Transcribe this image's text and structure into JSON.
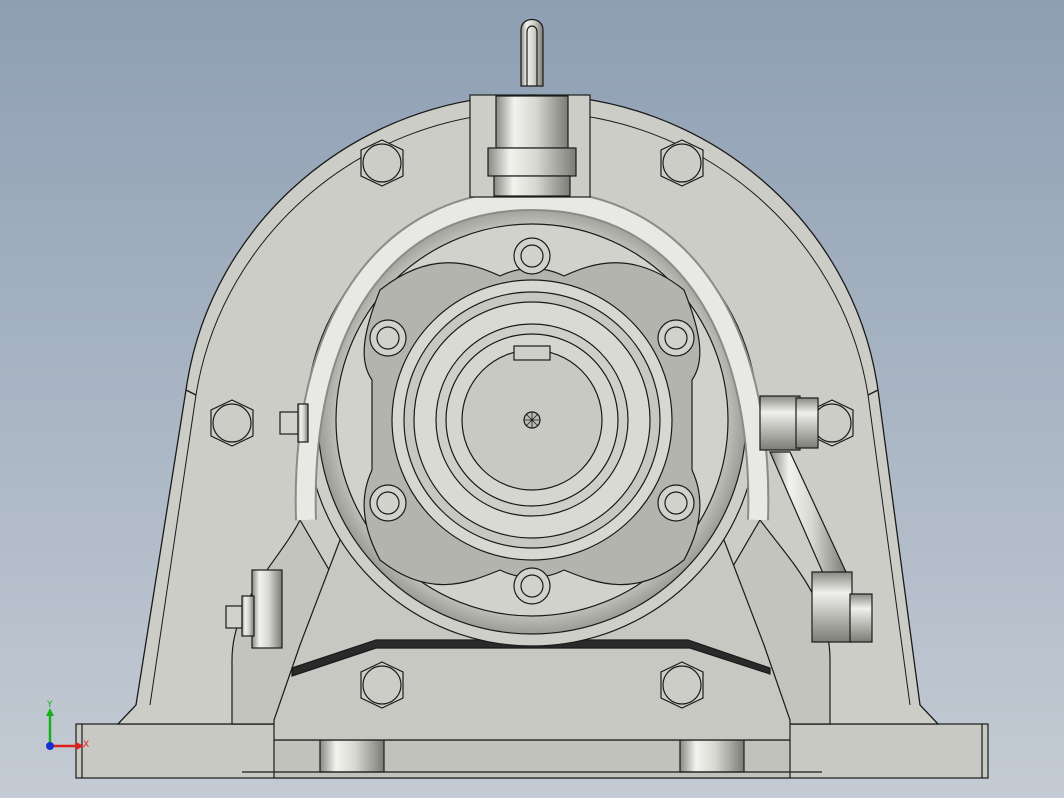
{
  "viewport": {
    "background_top": "#8e9fb3",
    "background_bottom": "#c4cbd4"
  },
  "model": {
    "body_color": "#cdcdc8",
    "body_shade": "#b9b9b3",
    "metal_light": "#ecece8",
    "metal_dark": "#8a8a84",
    "edge_color": "#1a1a1a"
  },
  "triad": {
    "x_label": "X",
    "y_label": "Y",
    "x_color": "#e02020",
    "y_color": "#18b018",
    "z_color": "#1530d0"
  }
}
